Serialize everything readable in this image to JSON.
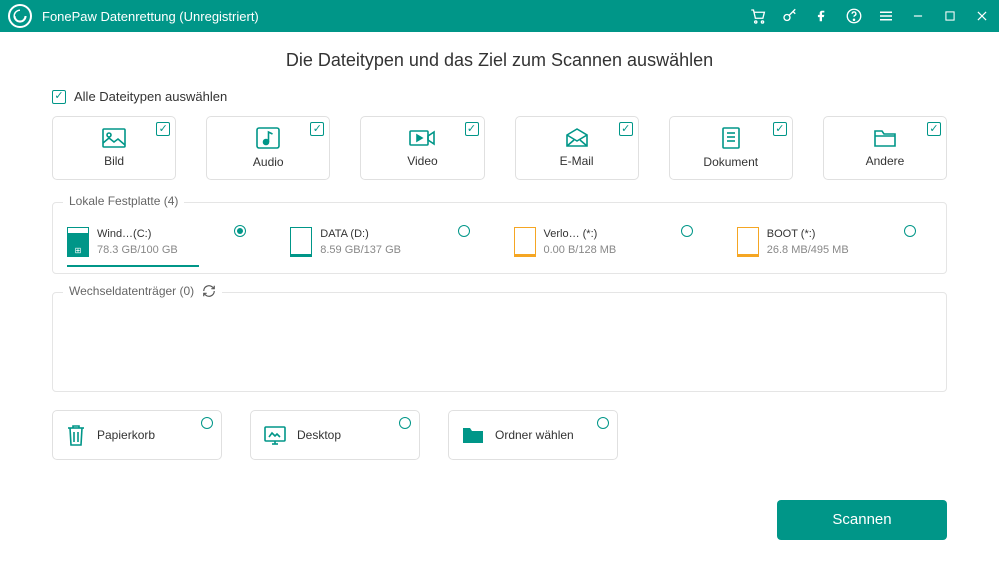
{
  "window": {
    "title": "FonePaw Datenrettung (Unregistriert)"
  },
  "heading": "Die Dateitypen und das Ziel zum Scannen auswählen",
  "selectAll": {
    "label": "Alle Dateitypen auswählen",
    "checked": true
  },
  "types": [
    {
      "key": "bild",
      "label": "Bild",
      "checked": true
    },
    {
      "key": "audio",
      "label": "Audio",
      "checked": true
    },
    {
      "key": "video",
      "label": "Video",
      "checked": true
    },
    {
      "key": "email",
      "label": "E-Mail",
      "checked": true
    },
    {
      "key": "dokument",
      "label": "Dokument",
      "checked": true
    },
    {
      "key": "andere",
      "label": "Andere",
      "checked": true
    }
  ],
  "localDisk": {
    "legend": "Lokale Festplatte (4)",
    "drives": [
      {
        "name": "Wind…(C:)",
        "size": "78.3 GB/100 GB",
        "selected": true,
        "color": "#009688",
        "fillPct": 78,
        "os": true
      },
      {
        "name": "DATA (D:)",
        "size": "8.59 GB/137 GB",
        "selected": false,
        "color": "#009688",
        "fillPct": 6,
        "os": false
      },
      {
        "name": "Verlo… (*:)",
        "size": "0.00  B/128 MB",
        "selected": false,
        "color": "#f5a623",
        "fillPct": 0,
        "os": false
      },
      {
        "name": "BOOT (*:)",
        "size": "26.8 MB/495 MB",
        "selected": false,
        "color": "#f5a623",
        "fillPct": 5,
        "os": false
      }
    ]
  },
  "removable": {
    "legend": "Wechseldatenträger (0)"
  },
  "locations": {
    "recycle": "Papierkorb",
    "desktop": "Desktop",
    "folder": "Ordner wählen"
  },
  "scanButton": "Scannen",
  "colors": {
    "accent": "#009688",
    "orange": "#f5a623"
  }
}
